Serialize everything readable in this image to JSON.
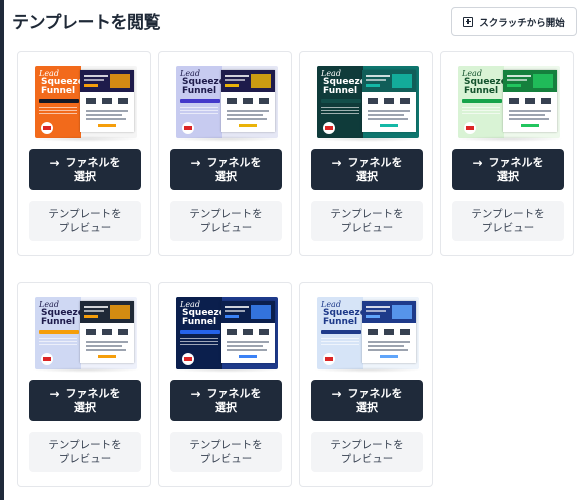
{
  "page": {
    "title": "テンプレートを閲覧",
    "start_button_label": "スクラッチから開始"
  },
  "thumbnail_text": {
    "script_word": "Lead",
    "headline_line1": "Squeeze",
    "headline_line2": "Funnel",
    "tag": "FUNNEL STEPS - 2"
  },
  "cards": [
    {
      "select_line1": "ファネルを",
      "select_line2": "選択",
      "preview_line1": "テンプレートを",
      "preview_line2": "プレビュー",
      "theme": {
        "left": "#f26a1b",
        "right": "#f5f5f5",
        "head": "#1e1b4b",
        "tag": "#111827",
        "accent": "#f59e0b",
        "text": "#ffffff"
      }
    },
    {
      "select_line1": "ファネルを",
      "select_line2": "選択",
      "preview_line1": "テンプレートを",
      "preview_line2": "プレビュー",
      "theme": {
        "left": "#c7cbf0",
        "right": "#e5e7f5",
        "head": "#1e1b4b",
        "tag": "#4338ca",
        "accent": "#eab308",
        "text": "#1e1b4b"
      }
    },
    {
      "select_line1": "ファネルを",
      "select_line2": "選択",
      "preview_line1": "テンプレートを",
      "preview_line2": "プレビュー",
      "theme": {
        "left": "#0f3b3a",
        "right": "#0f766e",
        "head": "#115e59",
        "tag": "#134e4a",
        "accent": "#14b8a6",
        "text": "#ffffff"
      }
    },
    {
      "select_line1": "ファネルを",
      "select_line2": "選択",
      "preview_line1": "テンプレートを",
      "preview_line2": "プレビュー",
      "theme": {
        "left": "#d9f3d5",
        "right": "#eef9ec",
        "head": "#15803d",
        "tag": "#16a34a",
        "accent": "#22c55e",
        "text": "#14532d"
      }
    },
    {
      "select_line1": "ファネルを",
      "select_line2": "選択",
      "preview_line1": "テンプレートを",
      "preview_line2": "プレビュー",
      "theme": {
        "left": "#cfd8f3",
        "right": "#eef1fb",
        "head": "#1f2937",
        "tag": "#f59e0b",
        "accent": "#f59e0b",
        "text": "#1e1b4b"
      }
    },
    {
      "select_line1": "ファネルを",
      "select_line2": "選択",
      "preview_line1": "テンプレートを",
      "preview_line2": "プレビュー",
      "theme": {
        "left": "#0b1f4d",
        "right": "#1e3a8a",
        "head": "#0b1f4d",
        "tag": "#2563eb",
        "accent": "#3b82f6",
        "text": "#ffffff"
      }
    },
    {
      "select_line1": "ファネルを",
      "select_line2": "選択",
      "preview_line1": "テンプレートを",
      "preview_line2": "プレビュー",
      "theme": {
        "left": "#d6e4f7",
        "right": "#eef4fb",
        "head": "#1e3a8a",
        "tag": "#1e3a8a",
        "accent": "#60a5fa",
        "text": "#1e3a8a"
      }
    }
  ]
}
